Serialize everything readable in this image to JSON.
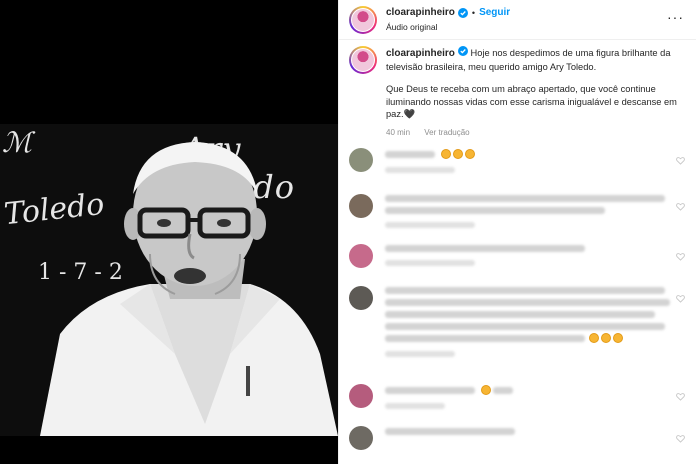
{
  "post": {
    "username": "cloarapinheiro",
    "follow_label": "Seguir",
    "audio_label": "Áudio original",
    "chalkboard": {
      "name_text": "Ary Toledo",
      "signature_text": "Toledo",
      "date_text": "1 - 7 - 2"
    }
  },
  "caption": {
    "username": "cloarapinheiro",
    "paragraph1": "Hoje nos despedimos de uma figura brilhante da televisão brasileira, meu querido amigo Ary Toledo.",
    "paragraph2": "Que Deus te receba com um abraço apertado, que você continue iluminando nossas vidas com esse carisma inigualável e descanse em paz.🖤",
    "time": "40 min",
    "translate_label": "Ver tradução"
  },
  "comments": [
    {
      "avatar_color": "#8a8f7a",
      "emoji_count": 3
    },
    {
      "avatar_color": "#7a6a5c",
      "emoji_count": 0
    },
    {
      "avatar_color": "#c66a8b",
      "emoji_count": 0
    },
    {
      "avatar_color": "#5d5a55",
      "emoji_count": 3
    },
    {
      "avatar_color": "#b55c7d",
      "emoji_count": 1
    },
    {
      "avatar_color": "#6e6a63",
      "emoji_count": 0
    }
  ],
  "colors": {
    "accent": "#0095f6",
    "verified": "#0095f6",
    "muted": "#8e8e8e"
  }
}
